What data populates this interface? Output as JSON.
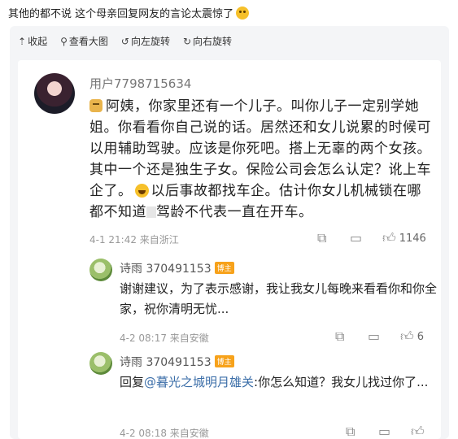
{
  "caption": {
    "text": "其他的都不说 这个母亲回复网友的言论太震惊了"
  },
  "toolbar": {
    "collapse": "收起",
    "view_large": "查看大图",
    "rotate_left": "向左旋转",
    "rotate_right": "向右旋转"
  },
  "main_comment": {
    "username": "用户7798715634",
    "text_part1": "阿姨，你家里还有一个儿子。叫你儿子一定别学她姐。你看看你自己说的话。居然还和女儿说累的时候可以用辅助驾驶。应该是你死吧。搭上无辜的两个女孩。其中一个还是独生子女。保险公司会怎么认定？讹上车企了。",
    "text_part2": "以后事故都找车企。估计你女儿机械锁在哪都不知道",
    "text_part3": "驾龄不代表一直在开车。",
    "meta": "4-1 21:42  来自浙江",
    "likes": "1146"
  },
  "reply1": {
    "username": "诗雨 370491153",
    "badge": "博主",
    "text": "谢谢建议，为了表示感谢，我让我女儿每晚来看看你和你全家，祝你清明无忧...",
    "meta": "4-2 08:17  来自安徽",
    "likes": "6"
  },
  "reply2": {
    "username": "诗雨 370491153",
    "badge": "博主",
    "reply_prefix": "回复",
    "mention": "@暮光之城明月雄关",
    "text": ":你怎么知道？我女儿找过你了...",
    "meta": "4-2 08:18  来自安徽",
    "likes": ""
  },
  "icons": {
    "repost": "share-icon",
    "comment": "comment-icon",
    "like": "thumbs-up-icon"
  }
}
